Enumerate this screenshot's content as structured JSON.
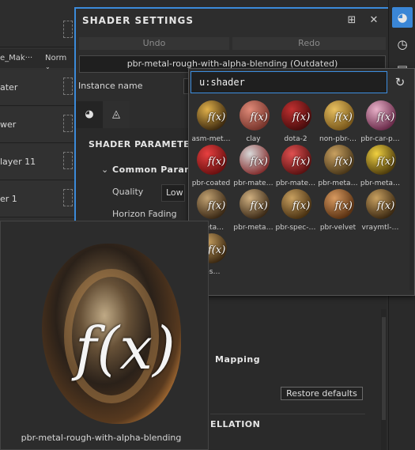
{
  "layers": {
    "header_left": "e_Mak···",
    "header_right": "Norm",
    "items": [
      {
        "label": "ater"
      },
      {
        "label": "wer"
      },
      {
        "label": "layer 11"
      },
      {
        "label": "er 1"
      }
    ]
  },
  "window": {
    "title": "SHADER SETTINGS",
    "undo_label": "Undo",
    "redo_label": "Redo",
    "shader_name": "pbr-metal-rough-with-alpha-blending (Outdated)",
    "instance_label": "Instance name",
    "sections": {
      "shader_params": "SHADER PARAMETE",
      "common": "Common Param",
      "quality_label": "Quality",
      "quality_value": "Low",
      "horizon_label": "Horizon Fading",
      "mapping": "Mapping",
      "restore": "Restore defaults",
      "tessellation": "ELLATION"
    }
  },
  "picker": {
    "search_value": "u:shader",
    "items": [
      {
        "label": "asm-met…",
        "colors": [
          "#e0b04a",
          "#2a1a08"
        ]
      },
      {
        "label": "clay",
        "colors": [
          "#e08a78",
          "#6a2a22"
        ]
      },
      {
        "label": "dota-2",
        "colors": [
          "#c03030",
          "#3a0808"
        ]
      },
      {
        "label": "non-pbr-…",
        "colors": [
          "#e8c060",
          "#6a4a12"
        ]
      },
      {
        "label": "pbr-car-p…",
        "colors": [
          "#e8b0c8",
          "#5a1a3a"
        ]
      },
      {
        "label": "pbr-coated",
        "colors": [
          "#e84040",
          "#5a0a0a"
        ]
      },
      {
        "label": "pbr-mate…",
        "colors": [
          "#d8d8d8",
          "#7a1a1a"
        ]
      },
      {
        "label": "pbr-mate…",
        "colors": [
          "#e05050",
          "#4a0a0a"
        ]
      },
      {
        "label": "pbr-meta…",
        "colors": [
          "#c8a060",
          "#3a2a10"
        ]
      },
      {
        "label": "pbr-meta…",
        "colors": [
          "#f0d040",
          "#3a2a06"
        ]
      },
      {
        "label": "meta…",
        "colors": [
          "#c0a070",
          "#2a1a0a"
        ]
      },
      {
        "label": "pbr-meta…",
        "colors": [
          "#d0b080",
          "#2a1a0a"
        ]
      },
      {
        "label": "pbr-spec-…",
        "colors": [
          "#c8a060",
          "#3a2408"
        ]
      },
      {
        "label": "pbr-velvet",
        "colors": [
          "#d89a60",
          "#4a2408"
        ]
      },
      {
        "label": "vraymtl-…",
        "colors": [
          "#c8a060",
          "#2a1a08"
        ]
      },
      {
        "label": "tl-s…",
        "colors": [
          "#c8a060",
          "#2a1a08"
        ]
      }
    ]
  },
  "preview": {
    "label": "pbr-metal-rough-with-alpha-blending"
  },
  "accent_color": "#3b8ad9"
}
